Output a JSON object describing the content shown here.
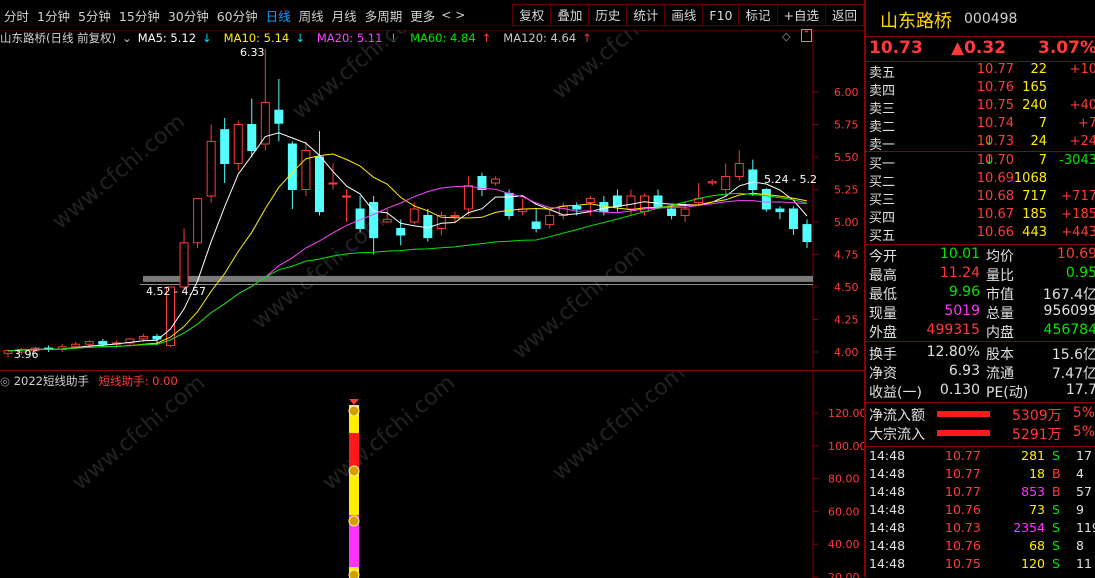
{
  "toolbar": {
    "periods": [
      "分时",
      "1分钟",
      "5分钟",
      "15分钟",
      "30分钟",
      "60分钟",
      "日线",
      "周线",
      "月线",
      "多周期",
      "更多"
    ],
    "active_period": "日线",
    "nav_prev": "<",
    "nav_next": ">",
    "tools": [
      "复权",
      "叠加",
      "历史",
      "统计",
      "画线",
      "F10",
      "标记",
      "+自选",
      "返回"
    ]
  },
  "main_chart": {
    "legend_title": "山东路桥(日线 前复权)",
    "ma": [
      {
        "label": "MA5: 5.12",
        "arrow": "↓",
        "color": "#ffffff"
      },
      {
        "label": "MA10: 5.14",
        "arrow": "↓",
        "color": "#ffee00"
      },
      {
        "label": "MA20: 5.11",
        "arrow": "↓",
        "color": "#ff44ff"
      },
      {
        "label": "MA60: 4.84",
        "arrow": "↑",
        "color": "#00e600"
      },
      {
        "label": "MA120: 4.64",
        "arrow": "↑",
        "color": "#c8c8c8"
      }
    ],
    "annotations": {
      "high": "6.33",
      "low": "3.96",
      "range_left": "4.52 - 4.57",
      "range_right": "5.24 - 5.2"
    },
    "y_ticks": [
      "6.00",
      "5.75",
      "5.50",
      "5.25",
      "5.00",
      "4.75",
      "4.50",
      "4.25",
      "4.00"
    ]
  },
  "chart_data": {
    "type": "candlestick",
    "ylim": [
      3.9,
      6.4
    ],
    "candles": [
      [
        3.99,
        4.01,
        3.96,
        4.02
      ],
      [
        4.0,
        4.02,
        3.98,
        4.03
      ],
      [
        4.01,
        4.03,
        3.99,
        4.04
      ],
      [
        4.03,
        4.02,
        4.0,
        4.05
      ],
      [
        4.02,
        4.04,
        4.0,
        4.06
      ],
      [
        4.04,
        4.06,
        4.03,
        4.08
      ],
      [
        4.06,
        4.08,
        4.04,
        4.09
      ],
      [
        4.08,
        4.06,
        4.04,
        4.1
      ],
      [
        4.06,
        4.07,
        4.03,
        4.09
      ],
      [
        4.07,
        4.1,
        4.05,
        4.11
      ],
      [
        4.1,
        4.12,
        4.08,
        4.14
      ],
      [
        4.12,
        4.1,
        4.05,
        4.14
      ],
      [
        4.05,
        4.5,
        4.04,
        4.5
      ],
      [
        4.5,
        4.84,
        4.47,
        4.95
      ],
      [
        4.84,
        5.18,
        4.8,
        5.18
      ],
      [
        5.2,
        5.62,
        5.15,
        5.75
      ],
      [
        5.71,
        5.45,
        5.3,
        5.8
      ],
      [
        5.45,
        5.75,
        5.4,
        5.78
      ],
      [
        5.75,
        5.55,
        5.5,
        5.95
      ],
      [
        5.6,
        5.92,
        5.55,
        6.33
      ],
      [
        5.86,
        5.76,
        5.62,
        6.1
      ],
      [
        5.6,
        5.25,
        5.1,
        5.62
      ],
      [
        5.25,
        5.55,
        5.2,
        5.62
      ],
      [
        5.5,
        5.08,
        5.05,
        5.7
      ],
      [
        5.3,
        5.3,
        5.25,
        5.45
      ],
      [
        5.2,
        5.2,
        5.0,
        5.25
      ],
      [
        5.1,
        4.95,
        4.92,
        5.2
      ],
      [
        5.15,
        4.88,
        4.75,
        5.2
      ],
      [
        5.0,
        5.02,
        5.0,
        5.1
      ],
      [
        4.95,
        4.9,
        4.82,
        5.02
      ],
      [
        5.0,
        5.1,
        4.98,
        5.15
      ],
      [
        5.05,
        4.88,
        4.85,
        5.1
      ],
      [
        4.95,
        5.05,
        4.9,
        5.08
      ],
      [
        5.05,
        5.05,
        5.0,
        5.08
      ],
      [
        5.1,
        5.28,
        5.05,
        5.35
      ],
      [
        5.35,
        5.25,
        5.2,
        5.38
      ],
      [
        5.3,
        5.33,
        5.28,
        5.35
      ],
      [
        5.22,
        5.05,
        5.02,
        5.25
      ],
      [
        5.08,
        5.1,
        5.05,
        5.18
      ],
      [
        5.0,
        4.95,
        4.92,
        5.1
      ],
      [
        4.98,
        5.05,
        4.95,
        5.1
      ],
      [
        5.05,
        5.12,
        5.02,
        5.15
      ],
      [
        5.12,
        5.1,
        5.05,
        5.15
      ],
      [
        5.15,
        5.18,
        5.05,
        5.2
      ],
      [
        5.15,
        5.08,
        5.05,
        5.2
      ],
      [
        5.2,
        5.12,
        5.08,
        5.25
      ],
      [
        5.1,
        5.2,
        5.05,
        5.25
      ],
      [
        5.08,
        5.2,
        5.05,
        5.22
      ],
      [
        5.2,
        5.12,
        5.1,
        5.25
      ],
      [
        5.1,
        5.05,
        5.02,
        5.12
      ],
      [
        5.05,
        5.1,
        5.0,
        5.15
      ],
      [
        5.15,
        5.18,
        5.12,
        5.3
      ],
      [
        5.3,
        5.31,
        5.28,
        5.33
      ],
      [
        5.25,
        5.35,
        5.2,
        5.45
      ],
      [
        5.35,
        5.45,
        5.32,
        5.55
      ],
      [
        5.4,
        5.25,
        5.2,
        5.48
      ],
      [
        5.25,
        5.1,
        5.08,
        5.26
      ],
      [
        5.1,
        5.08,
        5.02,
        5.12
      ],
      [
        5.1,
        4.95,
        4.9,
        5.12
      ],
      [
        4.98,
        4.85,
        4.8,
        5.02
      ]
    ]
  },
  "sub_chart": {
    "title": "2022短线助手",
    "indicator_label": "短线助手: 0.00",
    "y_ticks": [
      "120.00",
      "100.00",
      "80.00",
      "60.00",
      "40.00",
      "20.00"
    ]
  },
  "quote": {
    "name": "山东路桥",
    "code": "000498",
    "price": "10.73",
    "change": "▲0.32",
    "pct": "3.07%",
    "asks": [
      {
        "label": "卖五",
        "price": "10.77",
        "vol": "22",
        "delta": "+10"
      },
      {
        "label": "卖四",
        "price": "10.76",
        "vol": "165",
        "delta": ""
      },
      {
        "label": "卖三",
        "price": "10.75",
        "vol": "240",
        "delta": "+40"
      },
      {
        "label": "卖二",
        "price": "10.74",
        "vol": "7",
        "delta": "+7"
      },
      {
        "label": "卖一",
        "price": "10.73",
        "vol": "24",
        "delta": "+24",
        "arrow": "↓"
      }
    ],
    "bids": [
      {
        "label": "买一",
        "price": "10.70",
        "vol": "7",
        "delta": "-3043",
        "arrow": "↓"
      },
      {
        "label": "买二",
        "price": "10.69",
        "vol": "1068",
        "delta": ""
      },
      {
        "label": "买三",
        "price": "10.68",
        "vol": "717",
        "delta": "+717"
      },
      {
        "label": "买四",
        "price": "10.67",
        "vol": "185",
        "delta": "+185"
      },
      {
        "label": "买五",
        "price": "10.66",
        "vol": "443",
        "delta": "+443"
      }
    ],
    "stats": [
      {
        "l1": "今开",
        "v1": "10.01",
        "l2": "均价",
        "v2": "10.69",
        "c1": "green",
        "c2": "red"
      },
      {
        "l1": "最高",
        "v1": "11.24",
        "l2": "量比",
        "v2": "0.95",
        "c1": "red",
        "c2": "green"
      },
      {
        "l1": "最低",
        "v1": "9.96",
        "l2": "市值",
        "v2": "167.4亿",
        "c1": "green",
        "c2": "white"
      },
      {
        "l1": "现量",
        "v1": "5019",
        "l2": "总量",
        "v2": "956099",
        "c1": "magenta",
        "c2": "white"
      },
      {
        "l1": "外盘",
        "v1": "499315",
        "l2": "内盘",
        "v2": "456784",
        "c1": "red",
        "c2": "green"
      }
    ],
    "stats2": [
      {
        "l1": "换手",
        "v1": "12.80%",
        "l2": "股本",
        "v2": "15.6亿"
      },
      {
        "l1": "净资",
        "v1": "6.93",
        "l2": "流通",
        "v2": "7.47亿"
      },
      {
        "l1": "收益(一)",
        "v1": "0.130",
        "l2": "PE(动)",
        "v2": "17.7"
      }
    ],
    "flows": [
      {
        "label": "净流入额",
        "value": "5309万",
        "pct": "5%"
      },
      {
        "label": "大宗流入",
        "value": "5291万",
        "pct": "5%"
      }
    ],
    "ticks": [
      {
        "time": "14:48",
        "price": "10.77",
        "vol": "281",
        "bs": "S",
        "num": "17",
        "pc": "red",
        "vc": "yellow",
        "bc": "green"
      },
      {
        "time": "14:48",
        "price": "10.77",
        "vol": "18",
        "bs": "B",
        "num": "4",
        "pc": "red",
        "vc": "yellow",
        "bc": "red"
      },
      {
        "time": "14:48",
        "price": "10.77",
        "vol": "853",
        "bs": "B",
        "num": "57",
        "pc": "red",
        "vc": "magenta",
        "bc": "red"
      },
      {
        "time": "14:48",
        "price": "10.76",
        "vol": "73",
        "bs": "S",
        "num": "9",
        "pc": "red",
        "vc": "yellow",
        "bc": "green"
      },
      {
        "time": "14:48",
        "price": "10.73",
        "vol": "2354",
        "bs": "S",
        "num": "119",
        "pc": "red",
        "vc": "magenta",
        "bc": "green"
      },
      {
        "time": "14:48",
        "price": "10.76",
        "vol": "68",
        "bs": "S",
        "num": "8",
        "pc": "red",
        "vc": "yellow",
        "bc": "green"
      },
      {
        "time": "14:48",
        "price": "10.75",
        "vol": "120",
        "bs": "S",
        "num": "11",
        "pc": "red",
        "vc": "yellow",
        "bc": "green"
      }
    ]
  },
  "colors": {
    "up": "#ff3a3a",
    "down": "#54ffff",
    "grid": "#8b0000"
  },
  "watermark": "www.cfchi.com"
}
